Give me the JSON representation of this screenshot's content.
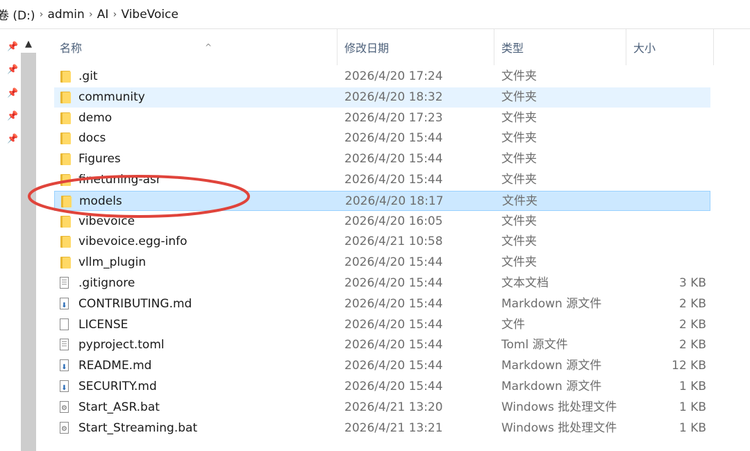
{
  "address_bar": {
    "crumbs": [
      "卷 (D:)",
      "admin",
      "AI",
      "VibeVoice"
    ],
    "separator": "›"
  },
  "header": {
    "name": "名称",
    "date": "修改日期",
    "type": "类型",
    "size": "大小",
    "sort_indicator": "^"
  },
  "nav": {
    "scroll_up": "▲"
  },
  "files": [
    {
      "name": ".git",
      "date": "2026/4/20 17:24",
      "type": "文件夹",
      "size": "",
      "icon": "folder-icon",
      "state": "normal"
    },
    {
      "name": "community",
      "date": "2026/4/20 18:32",
      "type": "文件夹",
      "size": "",
      "icon": "folder-icon",
      "state": "hover"
    },
    {
      "name": "demo",
      "date": "2026/4/20 17:23",
      "type": "文件夹",
      "size": "",
      "icon": "folder-icon",
      "state": "normal"
    },
    {
      "name": "docs",
      "date": "2026/4/20 15:44",
      "type": "文件夹",
      "size": "",
      "icon": "folder-icon",
      "state": "normal"
    },
    {
      "name": "Figures",
      "date": "2026/4/20 15:44",
      "type": "文件夹",
      "size": "",
      "icon": "folder-icon",
      "state": "normal"
    },
    {
      "name": "finetuning-asr",
      "date": "2026/4/20 15:44",
      "type": "文件夹",
      "size": "",
      "icon": "folder-icon",
      "state": "normal"
    },
    {
      "name": "models",
      "date": "2026/4/20 18:17",
      "type": "文件夹",
      "size": "",
      "icon": "folder-icon",
      "state": "selected"
    },
    {
      "name": "vibevoice",
      "date": "2026/4/20 16:05",
      "type": "文件夹",
      "size": "",
      "icon": "folder-icon",
      "state": "normal"
    },
    {
      "name": "vibevoice.egg-info",
      "date": "2026/4/21 10:58",
      "type": "文件夹",
      "size": "",
      "icon": "folder-icon",
      "state": "normal"
    },
    {
      "name": "vllm_plugin",
      "date": "2026/4/20 15:44",
      "type": "文件夹",
      "size": "",
      "icon": "folder-icon",
      "state": "normal"
    },
    {
      "name": ".gitignore",
      "date": "2026/4/20 15:44",
      "type": "文本文档",
      "size": "3 KB",
      "icon": "text-file-icon",
      "state": "normal"
    },
    {
      "name": "CONTRIBUTING.md",
      "date": "2026/4/20 15:44",
      "type": "Markdown 源文件",
      "size": "2 KB",
      "icon": "markdown-file-icon",
      "state": "normal"
    },
    {
      "name": "LICENSE",
      "date": "2026/4/20 15:44",
      "type": "文件",
      "size": "2 KB",
      "icon": "blank-file-icon",
      "state": "normal"
    },
    {
      "name": "pyproject.toml",
      "date": "2026/4/20 15:44",
      "type": "Toml 源文件",
      "size": "2 KB",
      "icon": "text-file-icon",
      "state": "normal"
    },
    {
      "name": "README.md",
      "date": "2026/4/20 15:44",
      "type": "Markdown 源文件",
      "size": "12 KB",
      "icon": "markdown-file-icon",
      "state": "normal"
    },
    {
      "name": "SECURITY.md",
      "date": "2026/4/20 15:44",
      "type": "Markdown 源文件",
      "size": "1 KB",
      "icon": "markdown-file-icon",
      "state": "normal"
    },
    {
      "name": "Start_ASR.bat",
      "date": "2026/4/21 13:20",
      "type": "Windows 批处理文件",
      "size": "1 KB",
      "icon": "batch-file-icon",
      "state": "normal"
    },
    {
      "name": "Start_Streaming.bat",
      "date": "2026/4/21 13:21",
      "type": "Windows 批处理文件",
      "size": "1 KB",
      "icon": "batch-file-icon",
      "state": "normal"
    }
  ],
  "colors": {
    "hover_bg": "#e5f3ff",
    "selected_bg": "#cce8ff",
    "selected_border": "#99d1ff",
    "annotation": "#e0443b",
    "folder": "#ffd966"
  }
}
